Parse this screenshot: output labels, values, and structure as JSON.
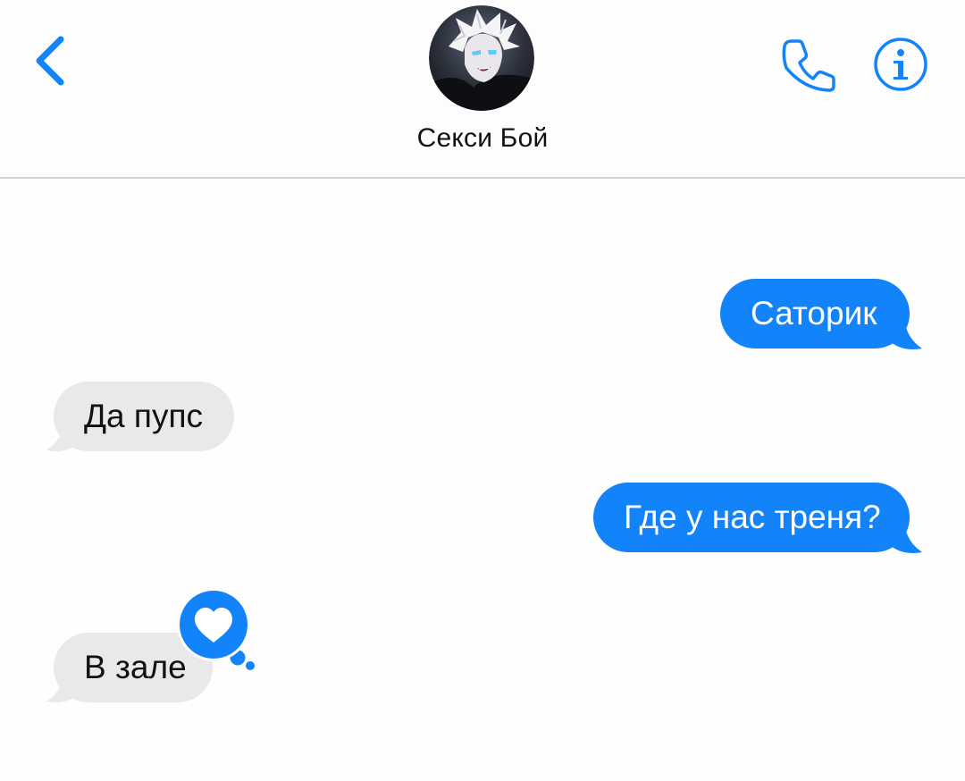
{
  "header": {
    "contact_name": "Секси Бой",
    "back_icon": "chevron-left-icon",
    "call_icon": "phone-icon",
    "info_icon": "info-icon"
  },
  "messages": [
    {
      "direction": "outgoing",
      "text": "Саторик"
    },
    {
      "direction": "incoming",
      "text": "Да пупс"
    },
    {
      "direction": "outgoing",
      "text": "Где у нас треня?"
    },
    {
      "direction": "incoming",
      "text": "В зале",
      "tapback": "heart-icon"
    }
  ],
  "colors": {
    "accent": "#1383f9",
    "incoming_bubble": "#e9e9eb",
    "background": "#fefefe",
    "divider": "#d4d4d6"
  }
}
